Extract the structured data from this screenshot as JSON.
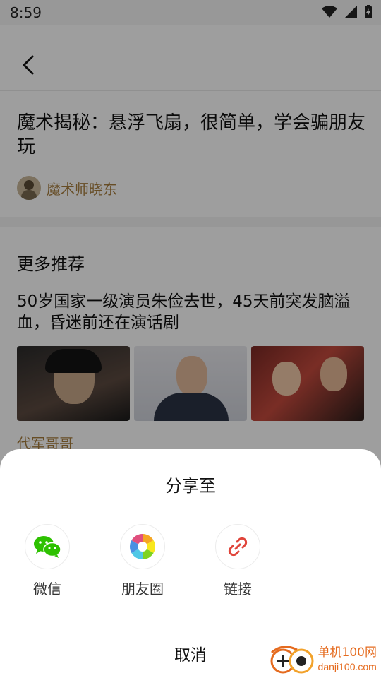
{
  "status_bar": {
    "time": "8:59"
  },
  "article": {
    "title": "魔术揭秘：悬浮飞扇，很简单，学会骗朋友玩",
    "author": "魔术师晓东"
  },
  "more_section": {
    "heading": "更多推荐",
    "recommendation_title": "50岁国家一级演员朱俭去世，45天前突发脑溢血，昏迷前还在演话剧",
    "source": "代军哥哥"
  },
  "share_sheet": {
    "title": "分享至",
    "options": [
      {
        "label": "微信",
        "icon": "wechat-icon",
        "color": "#2dc100"
      },
      {
        "label": "朋友圈",
        "icon": "moments-icon"
      },
      {
        "label": "链接",
        "icon": "link-icon",
        "color": "#e0443a"
      }
    ],
    "cancel": "取消"
  },
  "watermark": {
    "cn": "单机100网",
    "en": "danji100.com"
  }
}
